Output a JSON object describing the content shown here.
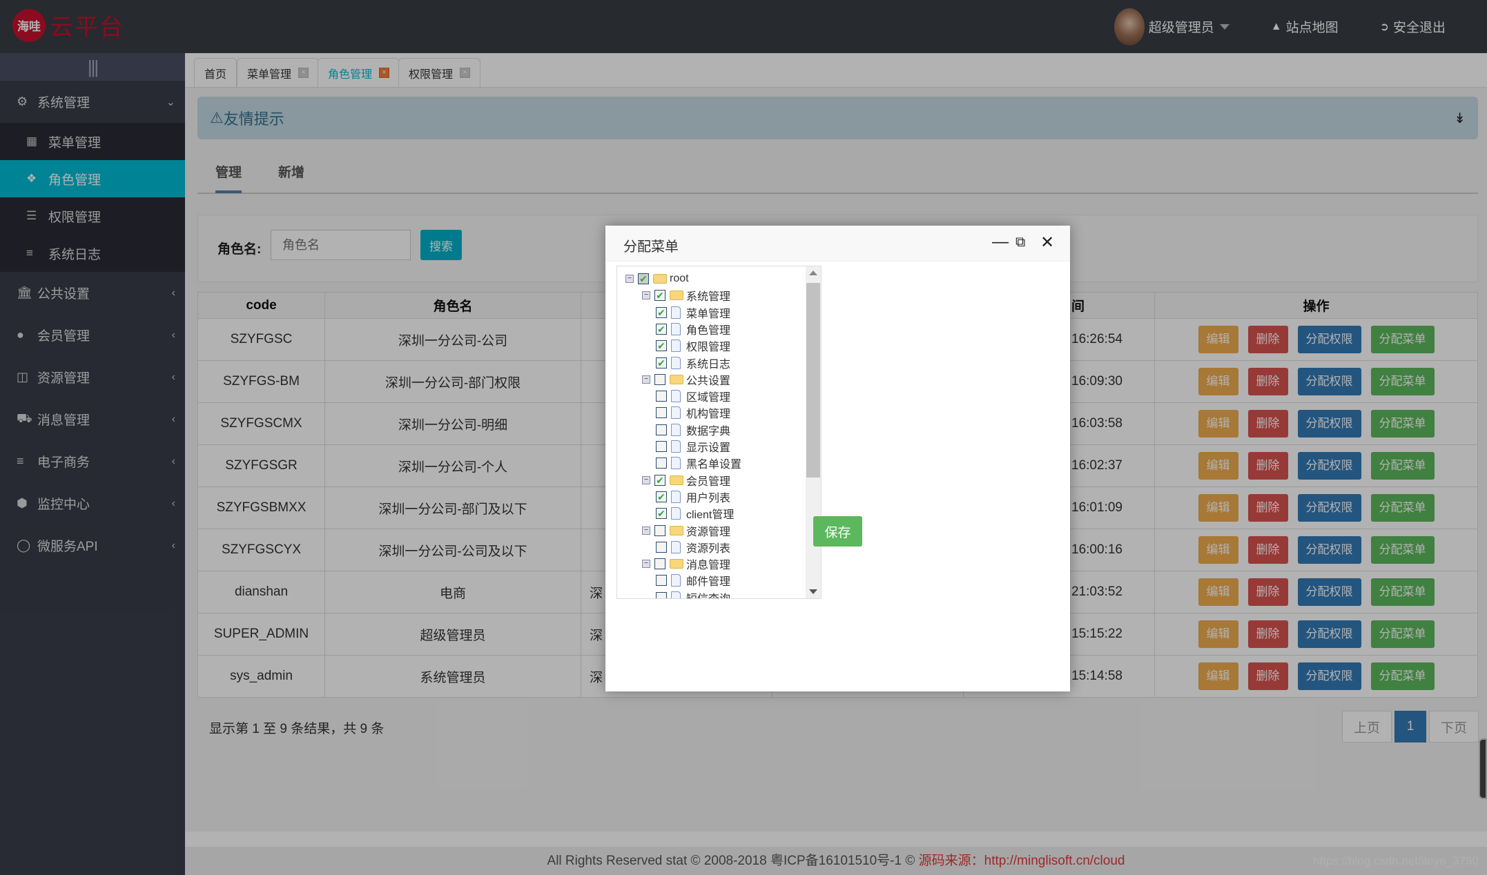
{
  "header": {
    "logo_badge": "海哇",
    "logo_text": "云平台",
    "user_name": "超级管理员",
    "sitemap_label": "站点地图",
    "logout_label": "安全退出"
  },
  "sidebar": {
    "toggle_icon": "|||",
    "groups": [
      {
        "label": "系统管理",
        "icon": "gears-icon",
        "expanded": true,
        "children": [
          {
            "label": "菜单管理",
            "icon": "windows-icon",
            "active": false
          },
          {
            "label": "角色管理",
            "icon": "cubes-icon",
            "active": true
          },
          {
            "label": "权限管理",
            "icon": "list-icon",
            "active": false
          },
          {
            "label": "系统日志",
            "icon": "bars-icon",
            "active": false
          }
        ]
      },
      {
        "label": "公共设置",
        "icon": "bank-icon"
      },
      {
        "label": "会员管理",
        "icon": "user-icon"
      },
      {
        "label": "资源管理",
        "icon": "file-code-icon"
      },
      {
        "label": "消息管理",
        "icon": "taxi-icon"
      },
      {
        "label": "电子商务",
        "icon": "sliders-icon"
      },
      {
        "label": "监控中心",
        "icon": "cube-icon"
      },
      {
        "label": "微服务API",
        "icon": "circle-icon"
      }
    ]
  },
  "tabs": [
    {
      "label": "首页",
      "closable": false,
      "active": false
    },
    {
      "label": "菜单管理",
      "closable": true,
      "active": false
    },
    {
      "label": "角色管理",
      "closable": true,
      "active": true
    },
    {
      "label": "权限管理",
      "closable": true,
      "active": false
    }
  ],
  "alert": {
    "title": "友情提示"
  },
  "subtabs": [
    {
      "label": "管理",
      "active": true
    },
    {
      "label": "新增",
      "active": false
    }
  ],
  "search": {
    "label": "角色名:",
    "value": "",
    "placeholder": "角色名",
    "button": "搜索"
  },
  "table": {
    "headers": [
      "code",
      "角色名",
      "",
      "",
      "间",
      "操作"
    ],
    "actions": [
      "编辑",
      "删除",
      "分配权限",
      "分配菜单"
    ],
    "rows": [
      {
        "code": "SZYFGSC",
        "name": "深圳一分公司-公司",
        "col3": "",
        "time": "16:26:54"
      },
      {
        "code": "SZYFGS-BM",
        "name": "深圳一分公司-部门权限",
        "col3": "",
        "time": "16:09:30"
      },
      {
        "code": "SZYFGSCMX",
        "name": "深圳一分公司-明细",
        "col3": "",
        "time": "16:03:58"
      },
      {
        "code": "SZYFGSGR",
        "name": "深圳一分公司-个人",
        "col3": "",
        "time": "16:02:37"
      },
      {
        "code": "SZYFGSBMXX",
        "name": "深圳一分公司-部门及以下",
        "col3": "",
        "time": "16:01:09"
      },
      {
        "code": "SZYFGSCYX",
        "name": "深圳一分公司-公司及以下",
        "col3": "",
        "time": "16:00:16"
      },
      {
        "code": "dianshan",
        "name": "电商",
        "col3": "深",
        "time": "21:03:52"
      },
      {
        "code": "SUPER_ADMIN",
        "name": "超级管理员",
        "col3": "深",
        "time": "15:15:22"
      },
      {
        "code": "sys_admin",
        "name": "系统管理员",
        "col3": "深",
        "time": "15:14:58"
      }
    ]
  },
  "pagination": {
    "info": "显示第 1 至 9 条结果，共 9 条",
    "prev": "上页",
    "current": "1",
    "next": "下页"
  },
  "footer": {
    "text": "All Rights Reserved stat © 2008-2018 粤ICP备16101510号-1 © ",
    "source_label": "源码来源：",
    "source_url": "http://minglisoft.cn/cloud",
    "watermark": "https://blog.csdn.net/iteye_3750"
  },
  "modal": {
    "title": "分配菜单",
    "save_label": "保存",
    "tree": [
      {
        "label": "root",
        "level": 0,
        "type": "folder",
        "checked": true,
        "partial": true
      },
      {
        "label": "系统管理",
        "level": 1,
        "type": "folder",
        "checked": true
      },
      {
        "label": "菜单管理",
        "level": 2,
        "type": "file",
        "checked": true
      },
      {
        "label": "角色管理",
        "level": 2,
        "type": "file",
        "checked": true
      },
      {
        "label": "权限管理",
        "level": 2,
        "type": "file",
        "checked": true
      },
      {
        "label": "系统日志",
        "level": 2,
        "type": "file",
        "checked": true
      },
      {
        "label": "公共设置",
        "level": 1,
        "type": "folder",
        "checked": false
      },
      {
        "label": "区域管理",
        "level": 2,
        "type": "file",
        "checked": false
      },
      {
        "label": "机构管理",
        "level": 2,
        "type": "file",
        "checked": false
      },
      {
        "label": "数据字典",
        "level": 2,
        "type": "file",
        "checked": false
      },
      {
        "label": "显示设置",
        "level": 2,
        "type": "file",
        "checked": false
      },
      {
        "label": "黑名单设置",
        "level": 2,
        "type": "file",
        "checked": false
      },
      {
        "label": "会员管理",
        "level": 1,
        "type": "folder",
        "checked": true
      },
      {
        "label": "用户列表",
        "level": 2,
        "type": "file",
        "checked": true
      },
      {
        "label": "client管理",
        "level": 2,
        "type": "file",
        "checked": true
      },
      {
        "label": "资源管理",
        "level": 1,
        "type": "folder",
        "checked": false
      },
      {
        "label": "资源列表",
        "level": 2,
        "type": "file",
        "checked": false
      },
      {
        "label": "消息管理",
        "level": 1,
        "type": "folder",
        "checked": false
      },
      {
        "label": "邮件管理",
        "level": 2,
        "type": "file",
        "checked": false
      },
      {
        "label": "短信查询",
        "level": 2,
        "type": "file",
        "checked": false
      }
    ]
  }
}
